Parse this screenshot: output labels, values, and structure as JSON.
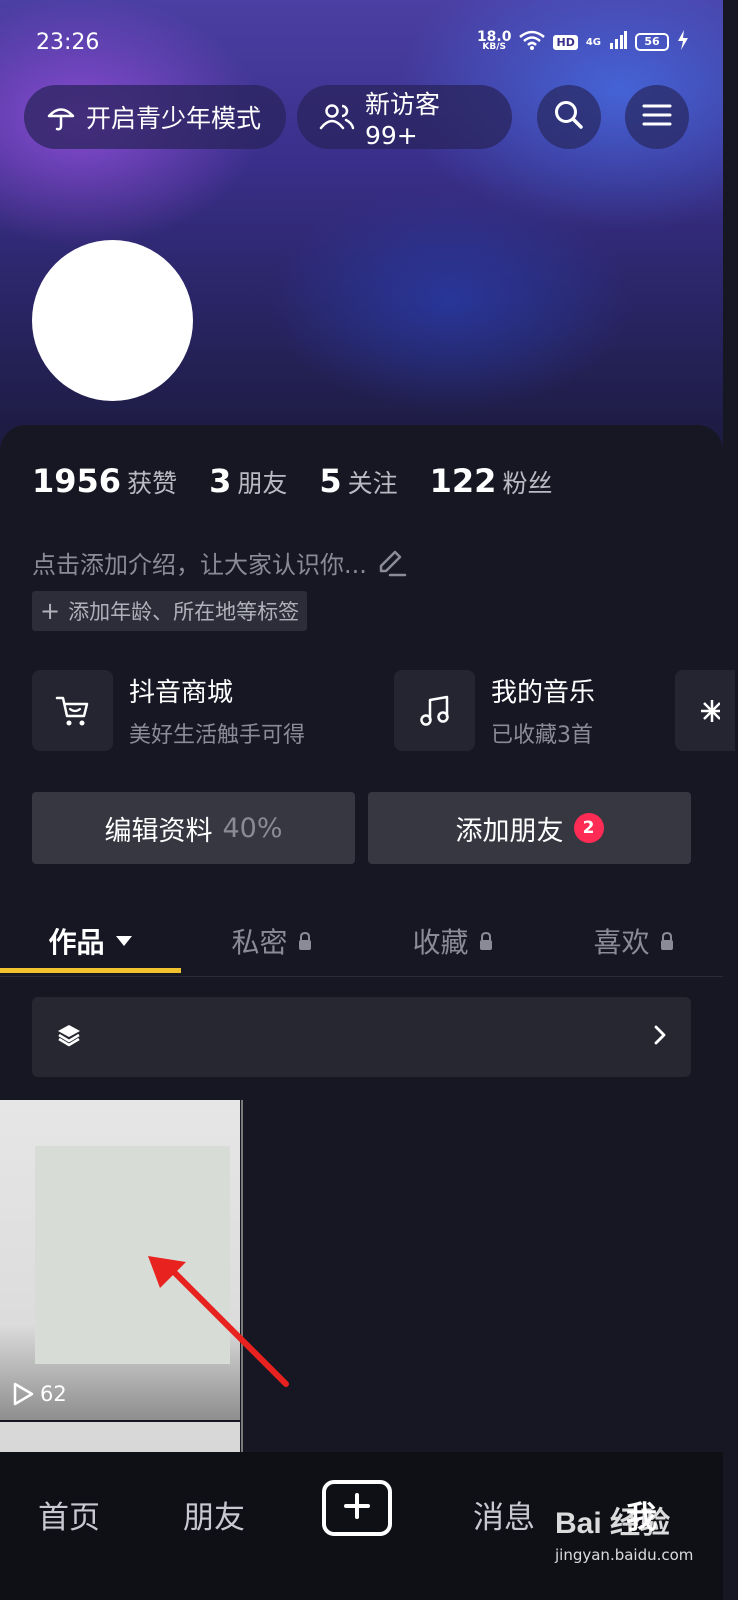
{
  "status_bar": {
    "time": "23:26",
    "net_speed_value": "18.0",
    "net_speed_unit": "KB/S",
    "hd": "HD",
    "signal": "4G",
    "battery": "56"
  },
  "header": {
    "teen_mode_label": "开启青少年模式",
    "visitors_label": "新访客 99+"
  },
  "stats": [
    {
      "number": "1956",
      "label": "获赞"
    },
    {
      "number": "3",
      "label": "朋友"
    },
    {
      "number": "5",
      "label": "关注"
    },
    {
      "number": "122",
      "label": "粉丝"
    }
  ],
  "profile": {
    "bio_placeholder": "点击添加介绍，让大家认识你...",
    "tags_label": "添加年龄、所在地等标签"
  },
  "services": [
    {
      "title": "抖音商城",
      "subtitle": "美好生活触手可得",
      "icon": "cart-icon"
    },
    {
      "title": "我的音乐",
      "subtitle": "已收藏3首",
      "icon": "music-icon"
    }
  ],
  "actions": {
    "edit_label": "编辑资料",
    "edit_progress": "40%",
    "add_friends_label": "添加朋友",
    "add_friends_badge": "2"
  },
  "tabs": [
    {
      "label": "作品",
      "active": true
    },
    {
      "label": "私密",
      "active": false
    },
    {
      "label": "收藏",
      "active": false
    },
    {
      "label": "喜欢",
      "active": false
    }
  ],
  "videos": [
    {
      "play_count": "62"
    }
  ],
  "bottom_nav": {
    "home": "首页",
    "friends": "朋友",
    "messages": "消息",
    "me": "我"
  },
  "watermark": {
    "brand": "Bai 经验",
    "site": "jingyan.baidu.com"
  },
  "colors": {
    "accent_tab": "#f2c12e",
    "badge_red": "#fe2c55",
    "annotation_arrow": "#e8231f"
  }
}
